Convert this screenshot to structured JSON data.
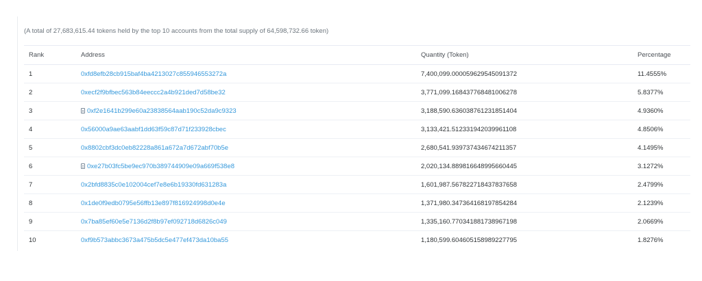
{
  "summary": "(A total of 27,683,615.44 tokens held by the top 10 accounts from the total supply of 64,598,732.66 token)",
  "columns": {
    "rank": "Rank",
    "address": "Address",
    "quantity": "Quantity (Token)",
    "percentage": "Percentage"
  },
  "icons": {
    "contract": "contract-document-icon"
  },
  "colors": {
    "link": "#3498db",
    "border": "#e7eaf3"
  },
  "rows": [
    {
      "rank": "1",
      "address": "0xfd8efb28cb915baf4ba4213027c855946553272a",
      "is_contract": false,
      "quantity": "7,400,099.000059629545091372",
      "percentage": "11.4555%"
    },
    {
      "rank": "2",
      "address": "0xecf2f9bfbec563b84eeccc2a4b921ded7d58be32",
      "is_contract": false,
      "quantity": "3,771,099.168437768481006278",
      "percentage": "5.8377%"
    },
    {
      "rank": "3",
      "address": "0xf2e1641b299e60a23838564aab190c52da9c9323",
      "is_contract": true,
      "quantity": "3,188,590.636038761231851404",
      "percentage": "4.9360%"
    },
    {
      "rank": "4",
      "address": "0x56000a9ae63aabf1dd63f59c87d71f233928cbec",
      "is_contract": false,
      "quantity": "3,133,421.512331942039961108",
      "percentage": "4.8506%"
    },
    {
      "rank": "5",
      "address": "0x8802cbf3dc0eb82228a861a672a7d672abf70b5e",
      "is_contract": false,
      "quantity": "2,680,541.939737434674211357",
      "percentage": "4.1495%"
    },
    {
      "rank": "6",
      "address": "0xe27b03fc5be9ec970b389744909e09a669f538e8",
      "is_contract": true,
      "quantity": "2,020,134.889816648995660445",
      "percentage": "3.1272%"
    },
    {
      "rank": "7",
      "address": "0x2bfd8835c0e102004cef7e8e6b19330fd631283a",
      "is_contract": false,
      "quantity": "1,601,987.567822718437837658",
      "percentage": "2.4799%"
    },
    {
      "rank": "8",
      "address": "0x1de0f9edb0795e56ffb13e897f816924998d0e4e",
      "is_contract": false,
      "quantity": "1,371,980.347364168197854284",
      "percentage": "2.1239%"
    },
    {
      "rank": "9",
      "address": "0x7ba85ef60e5e7136d2f8b97ef092718d6826c049",
      "is_contract": false,
      "quantity": "1,335,160.770341881738967198",
      "percentage": "2.0669%"
    },
    {
      "rank": "10",
      "address": "0xf9b573abbc3673a475b5dc5e477ef473da10ba55",
      "is_contract": false,
      "quantity": "1,180,599.604605158989227795",
      "percentage": "1.8276%"
    }
  ]
}
